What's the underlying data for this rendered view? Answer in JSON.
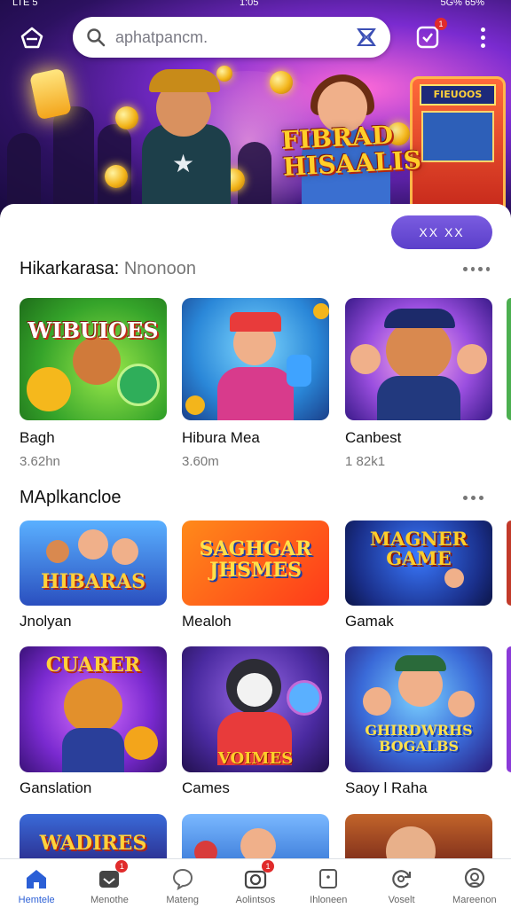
{
  "statusbar": {
    "left": "LTE 5",
    "time": "1:05",
    "right": "5G% 65%"
  },
  "search": {
    "placeholder": "aphatpancm."
  },
  "notification_badge": "1",
  "hero": {
    "title_line1": "FIBRAD",
    "title_line2": "HISAALIS",
    "arcade_marquee": "FIEUOOS"
  },
  "filter_button": "XX XX",
  "section1": {
    "title": "Hikarkarasa:",
    "subtitle": "Nnonoon",
    "items": [
      {
        "name": "Bagh",
        "meta": "3.62hn",
        "art_text": "WIBUIOES"
      },
      {
        "name": "Hibura Mea",
        "meta": "3.60m",
        "art_text": ""
      },
      {
        "name": "Canbest",
        "meta": "1 82k1",
        "art_text": ""
      }
    ]
  },
  "section2": {
    "title": "MAplkancloe",
    "items": [
      {
        "name": "Jnolyan",
        "art_text": "HIBARAS"
      },
      {
        "name": "Mealoh",
        "art_text": "SAGHGAR JHSMES"
      },
      {
        "name": "Gamak",
        "art_text": "MAGNER GAME"
      },
      {
        "name": "Ganslation",
        "art_text": "CUARER"
      },
      {
        "name": "Cames",
        "art_text": "VOIMES"
      },
      {
        "name": "Saoy l Raha",
        "art_text": "GHIRDWRHS BOGALBS"
      },
      {
        "name": "",
        "art_text": "WADIRES"
      }
    ]
  },
  "bottom_nav": [
    {
      "label": "Hemtele",
      "icon": "home-icon",
      "active": true
    },
    {
      "label": "Menothe",
      "icon": "inbox-icon",
      "badge": "1"
    },
    {
      "label": "Mateng",
      "icon": "chat-icon"
    },
    {
      "label": "Aolintsos",
      "icon": "camera-icon",
      "badge": "1"
    },
    {
      "label": "Ihloneen",
      "icon": "square-icon"
    },
    {
      "label": "Voselt",
      "icon": "refresh-icon"
    },
    {
      "label": "Mareenon",
      "icon": "profile-icon"
    }
  ],
  "colors": {
    "accent": "#5b3fca",
    "nav_active": "#2b5fd6",
    "badge": "#e02b2b"
  }
}
